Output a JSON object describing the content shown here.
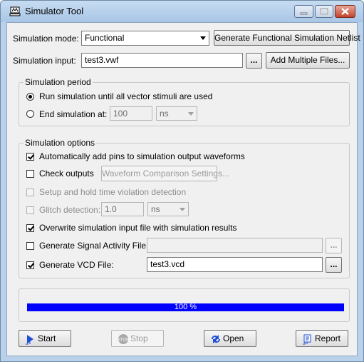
{
  "window": {
    "title": "Simulator Tool"
  },
  "mode": {
    "label": "Simulation mode:",
    "value": "Functional",
    "netlist_button": "Generate Functional Simulation Netlist"
  },
  "input": {
    "label": "Simulation input:",
    "value": "test3.vwf",
    "browse": "...",
    "add_files_button": "Add Multiple Files..."
  },
  "period": {
    "legend": "Simulation period",
    "run_until": "Run simulation until all vector stimuli are used",
    "end_at": "End simulation at:",
    "end_value": "100",
    "end_unit": "ns"
  },
  "options": {
    "legend": "Simulation options",
    "auto_add_pins": "Automatically add pins to simulation output waveforms",
    "check_outputs": "Check outputs",
    "waveform_settings_button": "Waveform Comparison Settings...",
    "setup_hold": "Setup and hold time violation detection",
    "glitch": "Glitch detection:",
    "glitch_value": "1.0",
    "glitch_unit": "ns",
    "overwrite": "Overwrite simulation input file with simulation results",
    "signal_activity": "Generate Signal Activity File:",
    "signal_activity_value": "",
    "signal_activity_browse": "...",
    "vcd": "Generate VCD File:",
    "vcd_value": "test3.vcd",
    "vcd_browse": "..."
  },
  "progress": {
    "text": "100 %",
    "percent": 100,
    "color": "#0000ff"
  },
  "actions": {
    "start": "Start",
    "stop": "Stop",
    "open": "Open",
    "report": "Report"
  }
}
